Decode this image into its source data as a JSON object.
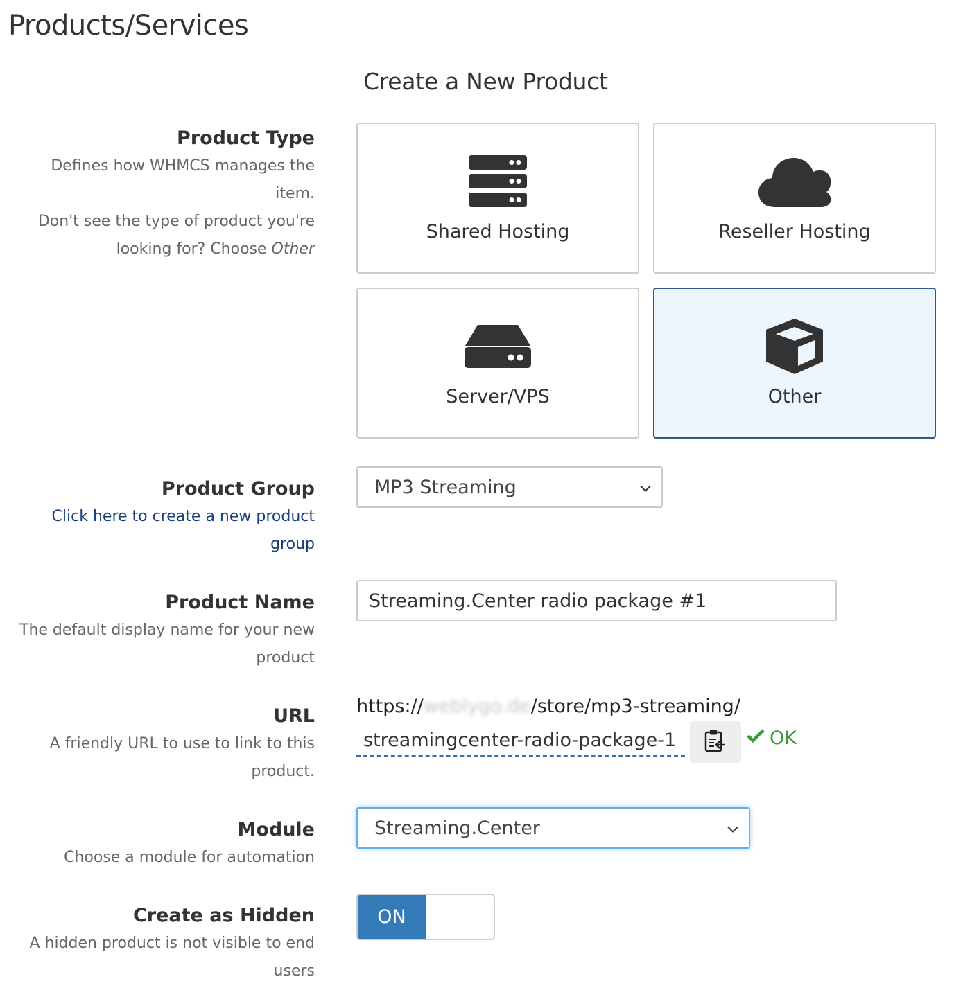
{
  "page": {
    "title": "Products/Services",
    "subtitle": "Create a New Product"
  },
  "product_type": {
    "label": "Product Type",
    "help_line1": "Defines how WHMCS manages the",
    "help_line2": "item.",
    "help_line3": "Don't see the type of product you're",
    "help_line4_prefix": "looking for? Choose ",
    "help_line4_em": "Other",
    "options": [
      {
        "label": "Shared Hosting",
        "icon": "server-stack-icon",
        "selected": false
      },
      {
        "label": "Reseller Hosting",
        "icon": "cloud-icon",
        "selected": false
      },
      {
        "label": "Server/VPS",
        "icon": "hdd-icon",
        "selected": false
      },
      {
        "label": "Other",
        "icon": "cube-icon",
        "selected": true
      }
    ]
  },
  "product_group": {
    "label": "Product Group",
    "link_line1": "Click here to create a new product",
    "link_line2": "group",
    "selected": "MP3 Streaming"
  },
  "product_name": {
    "label": "Product Name",
    "help_line1": "The default display name for your new",
    "help_line2": "product",
    "value": "Streaming.Center radio package #1"
  },
  "url": {
    "label": "URL",
    "help_line1": "A friendly URL to use to link to this",
    "help_line2": "product.",
    "prefix": "https://",
    "domain": "weblygo.de",
    "path": "/store/mp3-streaming/",
    "slug": "streamingcenter-radio-package-1",
    "status": "OK"
  },
  "module": {
    "label": "Module",
    "help": "Choose a module for automation",
    "selected": "Streaming.Center"
  },
  "hidden": {
    "label": "Create as Hidden",
    "help_line1": "A hidden product is not visible to end",
    "help_line2": "users",
    "toggle_label": "ON",
    "value": true
  },
  "colors": {
    "accent": "#337ab7",
    "selected_bg": "#eef6fd",
    "link": "#1a3f7a",
    "ok": "#3c9a3c"
  }
}
